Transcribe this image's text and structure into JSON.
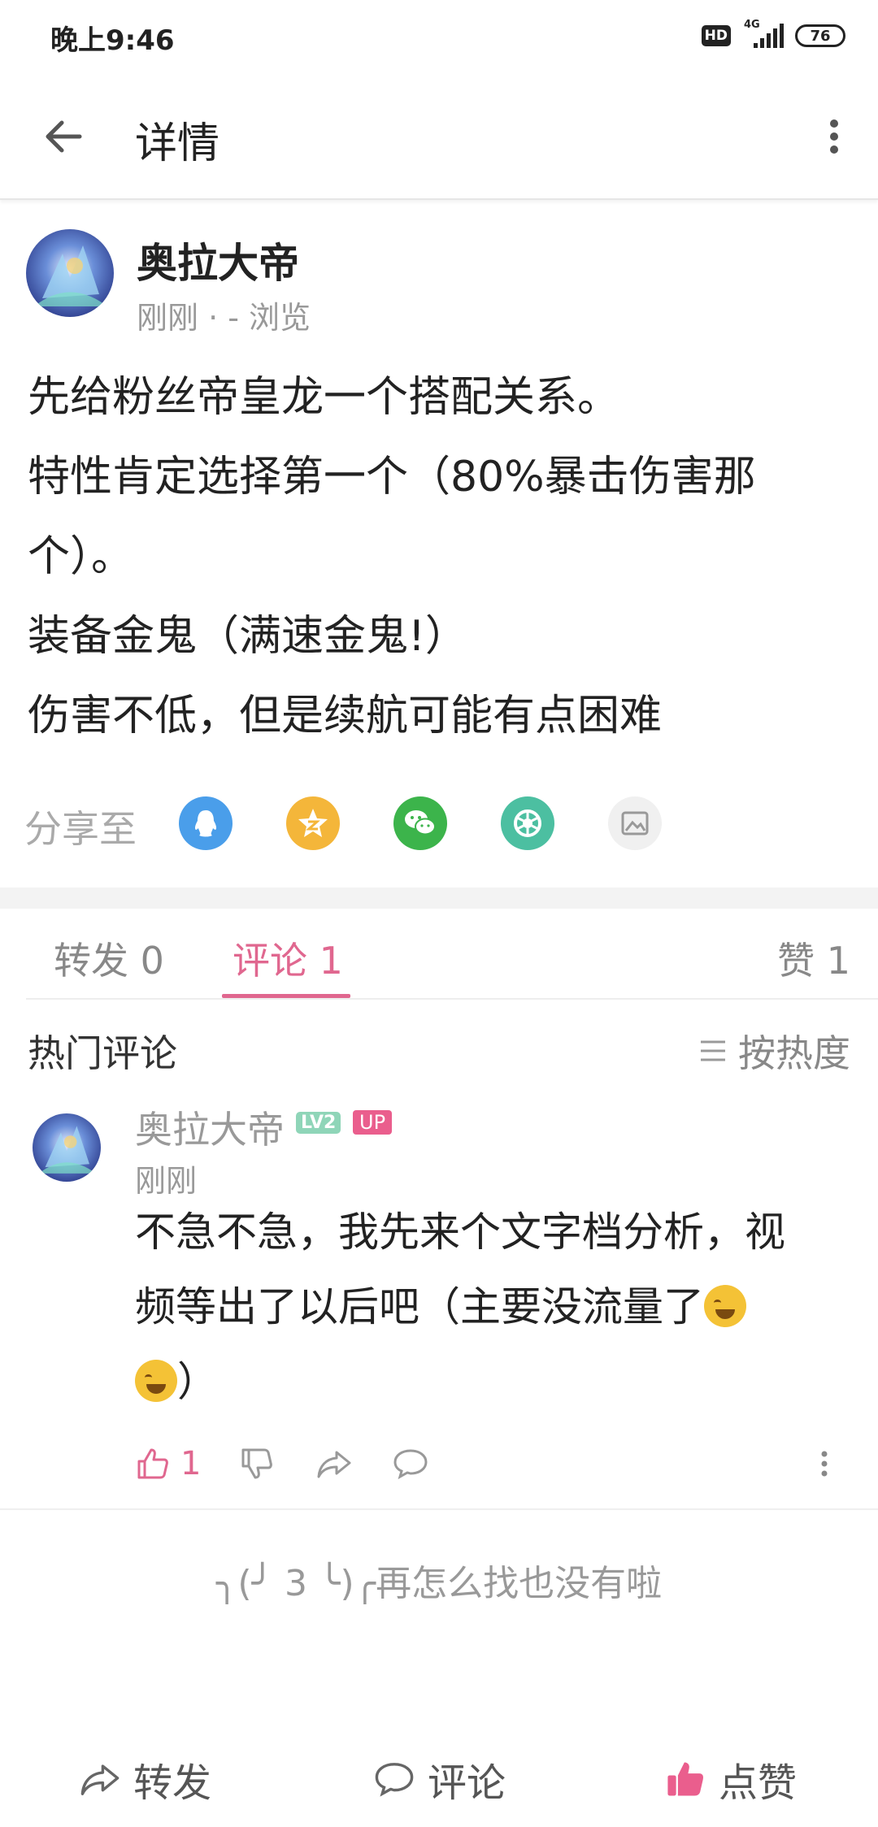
{
  "status_bar": {
    "time": "晚上9:46",
    "hd": "HD",
    "network": "4G",
    "battery": "76"
  },
  "appbar": {
    "title": "详情"
  },
  "post": {
    "author": "奥拉大帝",
    "meta": "刚刚 · - 浏览",
    "lines": [
      "先给粉丝帝皇龙一个搭配关系。",
      "特性肯定选择第一个（80%暴击伤害那",
      "个）。",
      "装备金鬼（满速金鬼!）",
      "伤害不低，但是续航可能有点困难"
    ]
  },
  "share": {
    "label": "分享至",
    "targets": [
      "qq",
      "qzone",
      "wechat",
      "moments",
      "image"
    ]
  },
  "tabs": {
    "repost": "转发 0",
    "comment": "评论 1",
    "like": "赞 1"
  },
  "comments_section": {
    "header": "热门评论",
    "sort": "按热度"
  },
  "comment": {
    "author": "奥拉大帝",
    "level": "LV2",
    "up_badge": "UP",
    "time": "刚刚",
    "line1": "不急不急，我先来个文字档分析，视",
    "line2": "频等出了以后吧（主要没流量了",
    "line3": "）",
    "likes": "1"
  },
  "end_text": "╮(╯ 3 ╰)╭再怎么找也没有啦",
  "bottom_bar": {
    "repost": "转发",
    "comment": "评论",
    "like": "点赞"
  },
  "colors": {
    "accent": "#e0678f",
    "qq": "#4a9eea",
    "qzone": "#f4b63a",
    "wechat": "#3cb44b",
    "moments": "#4cbfa1"
  }
}
